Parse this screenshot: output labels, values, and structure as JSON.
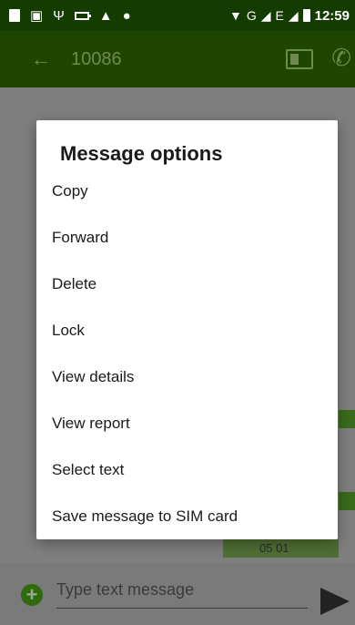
{
  "status_bar": {
    "clock": "12:59",
    "network_g": "G",
    "network_e": "E",
    "icons": [
      "sd-card-icon",
      "image-icon",
      "usb-icon",
      "battery-saver-icon",
      "warning-icon",
      "android-debug-icon",
      "wifi-icon",
      "signal-icon",
      "battery-icon"
    ]
  },
  "app_bar": {
    "back_icon": "←",
    "title": "10086",
    "contact_icon": "contact-card-icon",
    "call_icon": "✆"
  },
  "background": {
    "bubble_label": "05 01"
  },
  "compose": {
    "placeholder": "Type text message",
    "add_icon": "+",
    "send_icon": "send-icon"
  },
  "dialog": {
    "title": "Message options",
    "items": [
      {
        "label": "Copy"
      },
      {
        "label": "Forward"
      },
      {
        "label": "Delete"
      },
      {
        "label": "Lock"
      },
      {
        "label": "View details"
      },
      {
        "label": "View report"
      },
      {
        "label": "Select text"
      },
      {
        "label": "Save message to SIM card"
      }
    ]
  },
  "colors": {
    "status_bar": "#143c00",
    "app_bar": "#1e4600",
    "scrim": "#7f7f7f",
    "dialog": "#ffffff"
  }
}
